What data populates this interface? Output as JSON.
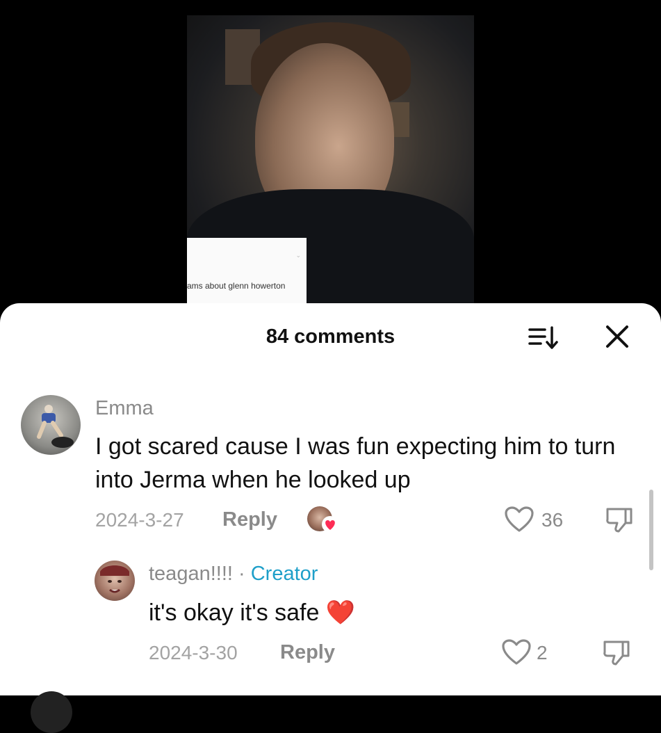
{
  "video": {
    "caption_text": "ams about glenn howerton"
  },
  "sheet": {
    "title": "84 comments",
    "sort_icon": "sort-icon",
    "close_icon": "close-icon"
  },
  "comments": [
    {
      "username": "Emma",
      "text": "I got scared cause I was fun expecting him to turn into Jerma when he looked up",
      "date": "2024-3-27",
      "reply_label": "Reply",
      "likes": "36",
      "creator_liked": true
    }
  ],
  "replies": [
    {
      "username": "teagan!!!!",
      "separator": "·",
      "badge": "Creator",
      "text": "it's okay it's safe",
      "emoji": "❤️",
      "date": "2024-3-30",
      "reply_label": "Reply",
      "likes": "2"
    }
  ],
  "colors": {
    "creator_badge": "#1e9fc9",
    "heart_badge": "#fe2c55"
  }
}
